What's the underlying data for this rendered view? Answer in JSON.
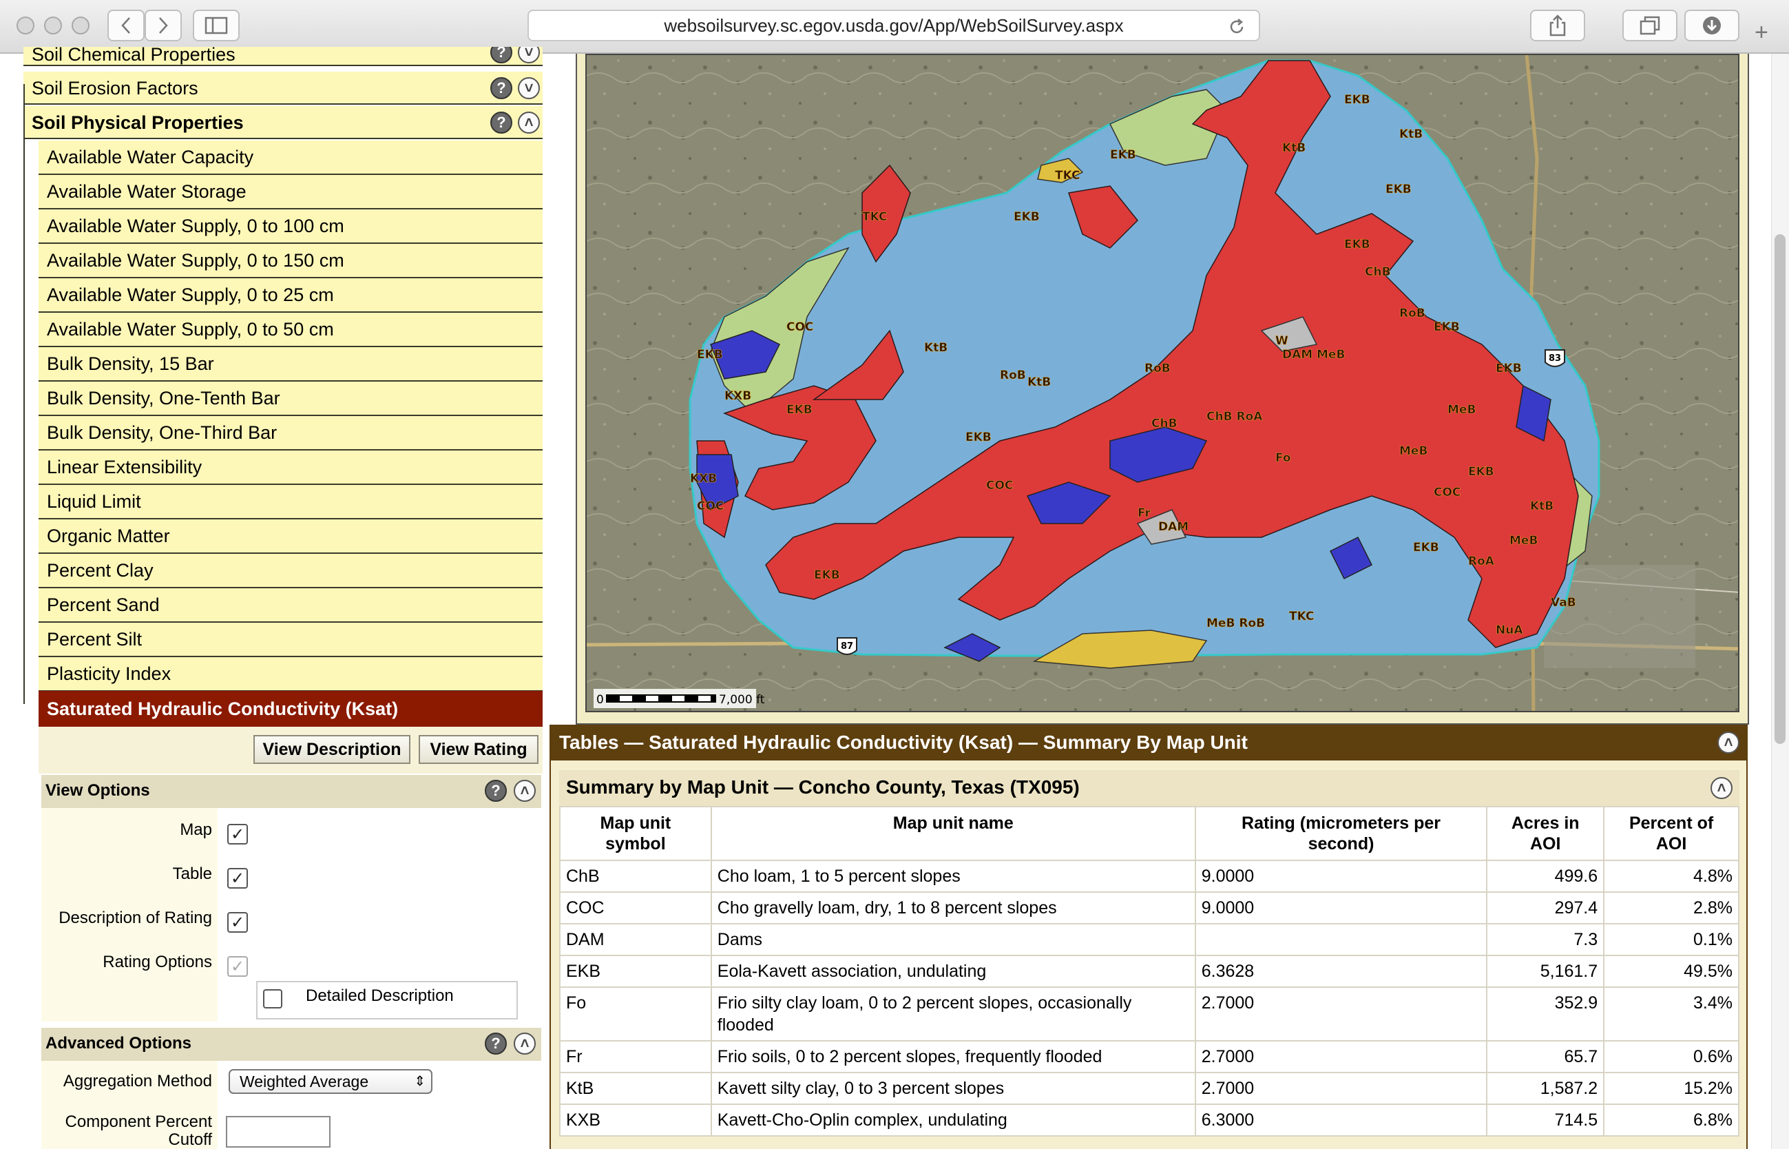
{
  "browser": {
    "url": "websoilsurvey.sc.egov.usda.gov/App/WebSoilSurvey.aspx"
  },
  "left_panel": {
    "categories": [
      {
        "label": "Soil Chemical Properties"
      },
      {
        "label": "Soil Erosion Factors"
      },
      {
        "label": "Soil Physical Properties"
      }
    ],
    "physical_items": [
      "Available Water Capacity",
      "Available Water Storage",
      "Available Water Supply, 0 to 100 cm",
      "Available Water Supply, 0 to 150 cm",
      "Available Water Supply, 0 to 25 cm",
      "Available Water Supply, 0 to 50 cm",
      "Bulk Density, 15 Bar",
      "Bulk Density, One-Tenth Bar",
      "Bulk Density, One-Third Bar",
      "Linear Extensibility",
      "Liquid Limit",
      "Organic Matter",
      "Percent Clay",
      "Percent Sand",
      "Percent Silt",
      "Plasticity Index"
    ],
    "selected_item": "Saturated Hydraulic Conductivity (Ksat)",
    "view_description_label": "View Description",
    "view_rating_label": "View Rating",
    "view_options": {
      "title": "View Options",
      "map_label": "Map",
      "table_label": "Table",
      "description_label": "Description of Rating",
      "rating_options_label": "Rating Options",
      "detailed_description_label": "Detailed Description",
      "map_checked": true,
      "table_checked": true,
      "description_checked": true,
      "rating_options_checked": true,
      "detailed_checked": false
    },
    "advanced_options": {
      "title": "Advanced Options",
      "aggregation_label": "Aggregation Method",
      "aggregation_value": "Weighted Average",
      "cutoff_label_line1": "Component Percent",
      "cutoff_label_line2": "Cutoff",
      "cutoff_value": ""
    },
    "help_glyph": "?",
    "collapse_glyph": "˄",
    "expand_glyph": "˅"
  },
  "map": {
    "scale_start": "0",
    "scale_end": "7,000 ft",
    "highway_labels": [
      "83",
      "87"
    ],
    "unit_labels": [
      "EKB",
      "KXB",
      "KtB",
      "TKC",
      "COC",
      "MeB",
      "RoB",
      "ChB",
      "DAM",
      "W",
      "Fo",
      "Fr",
      "RoA",
      "VaB",
      "NuA",
      "ChB RoA",
      "MeB RoB"
    ],
    "colors": {
      "high": "#7ab0d8",
      "mid_red": "#dd3a3a",
      "low_blue": "#3a3ac8",
      "green": "#b8d48a",
      "yellow": "#e0c040",
      "grey": "#bdbdbd",
      "outline": "#36c9c9"
    }
  },
  "tables": {
    "bar_title": "Tables — Saturated Hydraulic Conductivity (Ksat) — Summary By Map Unit",
    "summary_title": "Summary by Map Unit — Concho County, Texas (TX095)",
    "columns": [
      {
        "line1": "Map unit",
        "line2": "symbol"
      },
      {
        "line1": "Map unit name",
        "line2": ""
      },
      {
        "line1": "Rating (micrometers per",
        "line2": "second)"
      },
      {
        "line1": "Acres in",
        "line2": "AOI"
      },
      {
        "line1": "Percent of",
        "line2": "AOI"
      }
    ],
    "rows": [
      {
        "symbol": "ChB",
        "name": "Cho loam, 1 to 5 percent slopes",
        "rating": "9.0000",
        "acres": "499.6",
        "percent": "4.8%"
      },
      {
        "symbol": "COC",
        "name": "Cho gravelly loam, dry, 1 to 8 percent slopes",
        "rating": "9.0000",
        "acres": "297.4",
        "percent": "2.8%"
      },
      {
        "symbol": "DAM",
        "name": "Dams",
        "rating": "",
        "acres": "7.3",
        "percent": "0.1%"
      },
      {
        "symbol": "EKB",
        "name": "Eola-Kavett association, undulating",
        "rating": "6.3628",
        "acres": "5,161.7",
        "percent": "49.5%"
      },
      {
        "symbol": "Fo",
        "name": "Frio silty clay loam, 0 to 2 percent slopes, occasionally flooded",
        "rating": "2.7000",
        "acres": "352.9",
        "percent": "3.4%"
      },
      {
        "symbol": "Fr",
        "name": "Frio soils, 0 to 2 percent slopes, frequently flooded",
        "rating": "2.7000",
        "acres": "65.7",
        "percent": "0.6%"
      },
      {
        "symbol": "KtB",
        "name": "Kavett silty clay, 0 to 3 percent slopes",
        "rating": "2.7000",
        "acres": "1,587.2",
        "percent": "15.2%"
      },
      {
        "symbol": "KXB",
        "name": "Kavett-Cho-Oplin complex, undulating",
        "rating": "6.3000",
        "acres": "714.5",
        "percent": "6.8%"
      }
    ]
  }
}
